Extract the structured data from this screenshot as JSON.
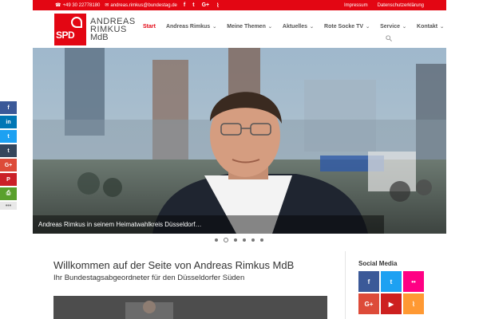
{
  "topbar": {
    "phone": "+49 30 22778180",
    "email": "andreas.rimkus@bundestag.de",
    "social": [
      {
        "icon": "facebook-icon",
        "glyph": "f"
      },
      {
        "icon": "twitter-icon",
        "glyph": "t"
      },
      {
        "icon": "google-plus-icon",
        "glyph": "G+"
      },
      {
        "icon": "rss-icon",
        "glyph": "⌇"
      }
    ],
    "links": [
      "Impressum",
      "Datenschutzerklärung"
    ]
  },
  "logo": {
    "badge": "SPD",
    "line1": "ANDREAS",
    "line2": "RIMKUS",
    "line3": "MdB"
  },
  "nav": {
    "items": [
      {
        "label": "Start",
        "active": true,
        "dropdown": false
      },
      {
        "label": "Andreas Rimkus",
        "active": false,
        "dropdown": true
      },
      {
        "label": "Meine Themen",
        "active": false,
        "dropdown": true
      },
      {
        "label": "Aktuelles",
        "active": false,
        "dropdown": true
      },
      {
        "label": "Rote Socke TV",
        "active": false,
        "dropdown": true
      },
      {
        "label": "Service",
        "active": false,
        "dropdown": true
      },
      {
        "label": "Kontakt",
        "active": false,
        "dropdown": true
      }
    ]
  },
  "slider": {
    "caption": "Andreas Rimkus in seinem Heimatwahlkreis Düsseldorf…",
    "slide_count": 6,
    "active_slide": 2
  },
  "share_bar": [
    {
      "icon": "facebook-icon",
      "glyph": "f",
      "color": "#3b5998"
    },
    {
      "icon": "linkedin-icon",
      "glyph": "in",
      "color": "#0077b5"
    },
    {
      "icon": "twitter-icon",
      "glyph": "t",
      "color": "#1da1f2"
    },
    {
      "icon": "tumblr-icon",
      "glyph": "t",
      "color": "#35465c"
    },
    {
      "icon": "google-plus-icon",
      "glyph": "G+",
      "color": "#dd4b39"
    },
    {
      "icon": "pinterest-icon",
      "glyph": "P",
      "color": "#cb2027"
    },
    {
      "icon": "print-icon",
      "glyph": "⎙",
      "color": "#5aa02c"
    },
    {
      "icon": "more-icon",
      "glyph": "•••",
      "color": "#e8e8e8"
    }
  ],
  "main": {
    "title": "Willkommen auf der Seite von Andreas Rimkus MdB",
    "subtitle": "Ihr Bundestagsabgeordneter für den Düsseldorfer Süden"
  },
  "social_media": {
    "title": "Social Media",
    "tiles": [
      {
        "icon": "facebook-icon",
        "glyph": "f",
        "color": "#3b5998"
      },
      {
        "icon": "twitter-icon",
        "glyph": "t",
        "color": "#1da1f2"
      },
      {
        "icon": "flickr-icon",
        "glyph": "••",
        "color": "#ff0084"
      },
      {
        "icon": "google-plus-icon",
        "glyph": "G+",
        "color": "#dd4b39"
      },
      {
        "icon": "youtube-icon",
        "glyph": "▶",
        "color": "#cd201f"
      },
      {
        "icon": "rss-icon",
        "glyph": "⌇",
        "color": "#ff9933"
      }
    ]
  },
  "colors": {
    "brand": "#e30613",
    "text": "#333333"
  }
}
